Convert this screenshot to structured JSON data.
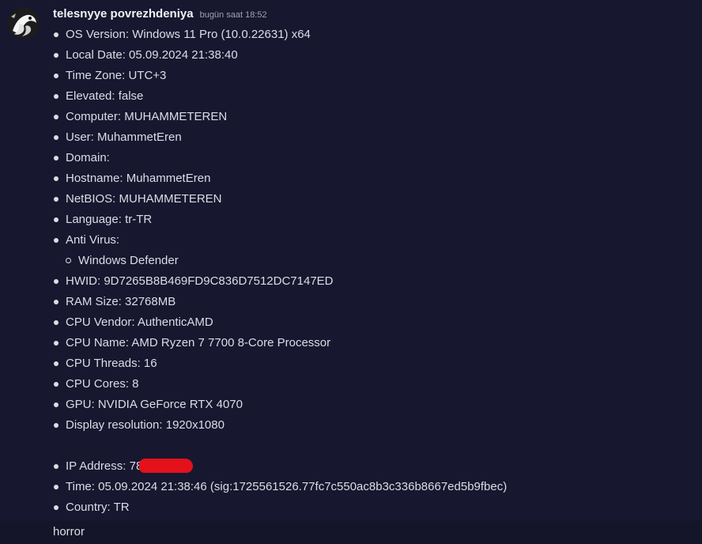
{
  "message": {
    "username": "telesnyye povrezhdeniya",
    "timestamp": "bugün saat 18:52",
    "avatar_icon": "avatar-icon",
    "items": {
      "os": "OS Version: Windows 11 Pro (10.0.22631) x64",
      "local_date": "Local Date: 05.09.2024 21:38:40",
      "time_zone": "Time Zone: UTC+3",
      "elevated": "Elevated: false",
      "computer": "Computer: MUHAMMETEREN",
      "user": "User: MuhammetEren",
      "domain": "Domain:",
      "hostname": "Hostname: MuhammetEren",
      "netbios": "NetBIOS: MUHAMMETEREN",
      "language": "Language: tr-TR",
      "antivirus": "Anti Virus:",
      "antivirus_item": "Windows Defender",
      "hwid": "HWID: 9D7265B8B469FD9C836D7512DC7147ED",
      "ram": "RAM Size: 32768MB",
      "cpu_vendor": "CPU Vendor: AuthenticAMD",
      "cpu_name": "CPU Name: AMD Ryzen 7 7700 8-Core Processor",
      "cpu_threads": "CPU Threads: 16",
      "cpu_cores": "CPU Cores: 8",
      "gpu": "GPU: NVIDIA GeForce RTX 4070",
      "display": "Display resolution: 1920x1080",
      "ip": "IP Address: 78",
      "time": "Time: 05.09.2024 21:38:46 (sig:1725561526.77fc7c550ac8b3c336b8667ed5b9fbec)",
      "country": "Country: TR"
    }
  },
  "next_message": {
    "text": "horror"
  },
  "colors": {
    "background": "#15152a",
    "message_bg": "#171730",
    "redaction": "#e3111a"
  }
}
